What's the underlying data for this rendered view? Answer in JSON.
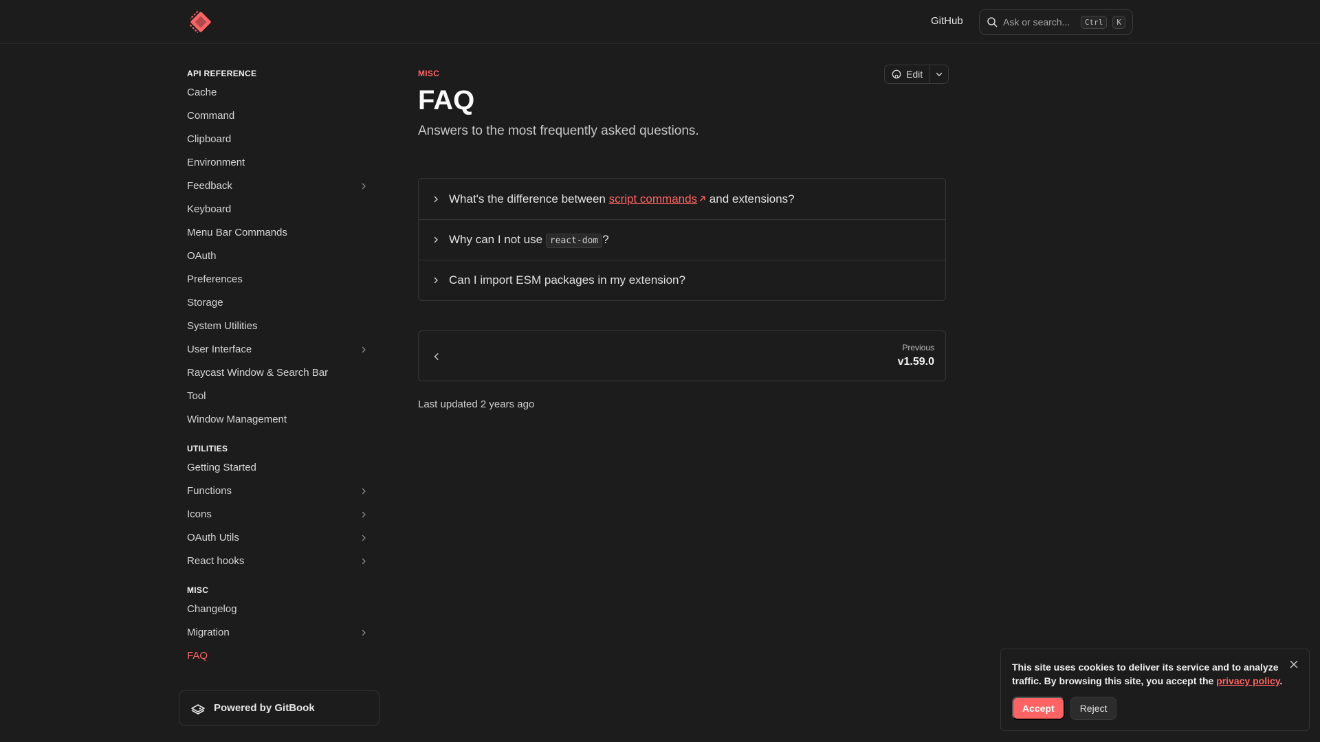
{
  "header": {
    "logo_icon": "raycast-logo-icon",
    "github_label": "GitHub",
    "search_placeholder": "Ask or search...",
    "shortcut_key1": "Ctrl",
    "shortcut_key2": "K"
  },
  "sidebar": {
    "sections": [
      {
        "title": "API REFERENCE",
        "items": [
          {
            "label": "Cache",
            "expandable": false
          },
          {
            "label": "Command",
            "expandable": false
          },
          {
            "label": "Clipboard",
            "expandable": false
          },
          {
            "label": "Environment",
            "expandable": false
          },
          {
            "label": "Feedback",
            "expandable": true
          },
          {
            "label": "Keyboard",
            "expandable": false
          },
          {
            "label": "Menu Bar Commands",
            "expandable": false
          },
          {
            "label": "OAuth",
            "expandable": false
          },
          {
            "label": "Preferences",
            "expandable": false
          },
          {
            "label": "Storage",
            "expandable": false
          },
          {
            "label": "System Utilities",
            "expandable": false
          },
          {
            "label": "User Interface",
            "expandable": true
          },
          {
            "label": "Raycast Window & Search Bar",
            "expandable": false
          },
          {
            "label": "Tool",
            "expandable": false
          },
          {
            "label": "Window Management",
            "expandable": false
          }
        ]
      },
      {
        "title": "UTILITIES",
        "items": [
          {
            "label": "Getting Started",
            "expandable": false
          },
          {
            "label": "Functions",
            "expandable": true
          },
          {
            "label": "Icons",
            "expandable": true
          },
          {
            "label": "OAuth Utils",
            "expandable": true
          },
          {
            "label": "React hooks",
            "expandable": true
          }
        ]
      },
      {
        "title": "MISC",
        "items": [
          {
            "label": "Changelog",
            "expandable": false
          },
          {
            "label": "Migration",
            "expandable": true
          },
          {
            "label": "FAQ",
            "expandable": false,
            "active": true
          }
        ]
      }
    ],
    "powered_by": "Powered by GitBook"
  },
  "main": {
    "eyebrow": "MISC",
    "title": "FAQ",
    "subtitle": "Answers to the most frequently asked questions.",
    "edit_label": "Edit",
    "faq": {
      "q1_before": "What's the difference between ",
      "q1_link": "script commands",
      "q1_after": " and extensions?",
      "q2_before": "Why can I not use ",
      "q2_code": "react-dom",
      "q2_after": "?",
      "q3": "Can I import ESM packages in my extension?"
    },
    "pager": {
      "label": "Previous",
      "title": "v1.59.0"
    },
    "last_updated": "Last updated 2 years ago"
  },
  "cookie": {
    "text": "This site uses cookies to deliver its service and to analyze traffic. By browsing this site, you accept the ",
    "link": "privacy policy",
    "text_end": ".",
    "accept": "Accept",
    "reject": "Reject"
  },
  "colors": {
    "accent": "#ff6363",
    "background": "#1c1c1c"
  }
}
